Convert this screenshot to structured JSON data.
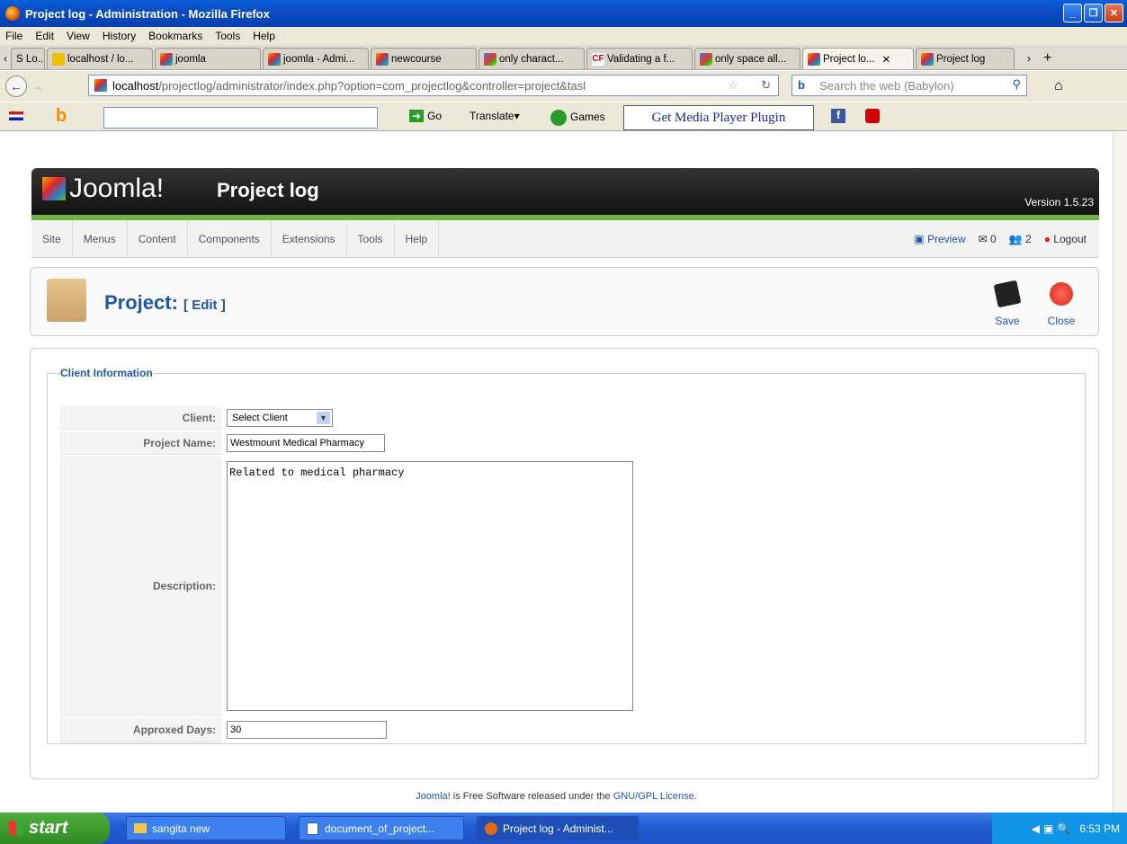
{
  "window": {
    "title": "Project log - Administration - Mozilla Firefox"
  },
  "menubar": [
    "File",
    "Edit",
    "View",
    "History",
    "Bookmarks",
    "Tools",
    "Help"
  ],
  "tabs": [
    {
      "label": "S Lo...",
      "icon": "page-icon"
    },
    {
      "label": "localhost / lo...",
      "icon": "phpmyadmin-icon"
    },
    {
      "label": "joomla",
      "icon": "joomla-icon"
    },
    {
      "label": "joomla - Admi...",
      "icon": "joomla-icon"
    },
    {
      "label": "newcourse",
      "icon": "joomla-icon"
    },
    {
      "label": "only charact...",
      "icon": "google-icon"
    },
    {
      "label": "Validating a f...",
      "icon": "cf-icon"
    },
    {
      "label": "only space all...",
      "icon": "google-icon"
    },
    {
      "label": "Project lo...",
      "icon": "joomla-icon",
      "active": true
    },
    {
      "label": "Project log",
      "icon": "joomla-icon"
    }
  ],
  "nav": {
    "url_host": "localhost",
    "url_path": "/projectlog/administrator/index.php?option=com_projectlog&controller=project&tasl",
    "search_placeholder": "Search the web (Babylon)"
  },
  "toolbar2": {
    "go": "Go",
    "translate": "Translate",
    "games": "Games",
    "media": "Get Media Player Plugin"
  },
  "joomla": {
    "logo": "Joomla!",
    "title": "Project log",
    "version": "Version 1.5.23",
    "menu": [
      "Site",
      "Menus",
      "Content",
      "Components",
      "Extensions",
      "Tools",
      "Help"
    ],
    "preview": "Preview",
    "messages": "0",
    "users": "2",
    "logout": "Logout"
  },
  "header": {
    "title": "Project:",
    "subtitle": "[ Edit ]",
    "save": "Save",
    "close": "Close"
  },
  "form": {
    "legend": "Client Information",
    "client_label": "Client:",
    "client_value": "Select Client",
    "project_name_label": "Project Name:",
    "project_name_value": "Westmount Medical Pharmacy",
    "description_label": "Description:",
    "description_value": "Related to medical pharmacy",
    "days_label": "Approxed Days:",
    "days_value": "30"
  },
  "footer": {
    "pre": "Joomla!",
    "mid": " is Free Software released under the ",
    "link": "GNU/GPL License",
    "post": "."
  },
  "taskbar": {
    "start": "start",
    "tasks": [
      "sangita new",
      "document_of_project...",
      "Project log - Administ..."
    ],
    "time": "6:53 PM"
  }
}
